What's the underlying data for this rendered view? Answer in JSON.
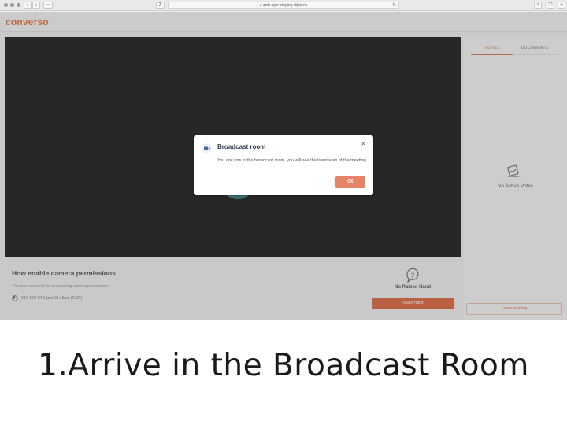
{
  "browser": {
    "new_tab_label": "Z",
    "url": "web.agm.staging.digla.co",
    "lock_icon": "lock-icon",
    "reload_icon": "reload-icon"
  },
  "app": {
    "logo": "converso",
    "brand_color": "#e9622c"
  },
  "sidebar": {
    "tabs": [
      {
        "label": "VOTES",
        "active": true
      },
      {
        "label": "DOCUMENTS",
        "active": false
      }
    ],
    "empty_state": "No Active Votes",
    "leave_label": "Leave meeting"
  },
  "event": {
    "title": "How enable camera permissions",
    "description": "This is a test event for showcasing camera permissions",
    "time": "03/14/22 04:15pm-05:15pm (GMT)"
  },
  "hand": {
    "status": "No Raised Hand",
    "raise_label": "Raise Hand"
  },
  "modal": {
    "title": "Broadcast room",
    "body": "You are now in the broadcast room, you will see the livestream of the meeting",
    "ok_label": "OK",
    "close_symbol": "×"
  },
  "caption": "1.Arrive in the Broadcast Room"
}
